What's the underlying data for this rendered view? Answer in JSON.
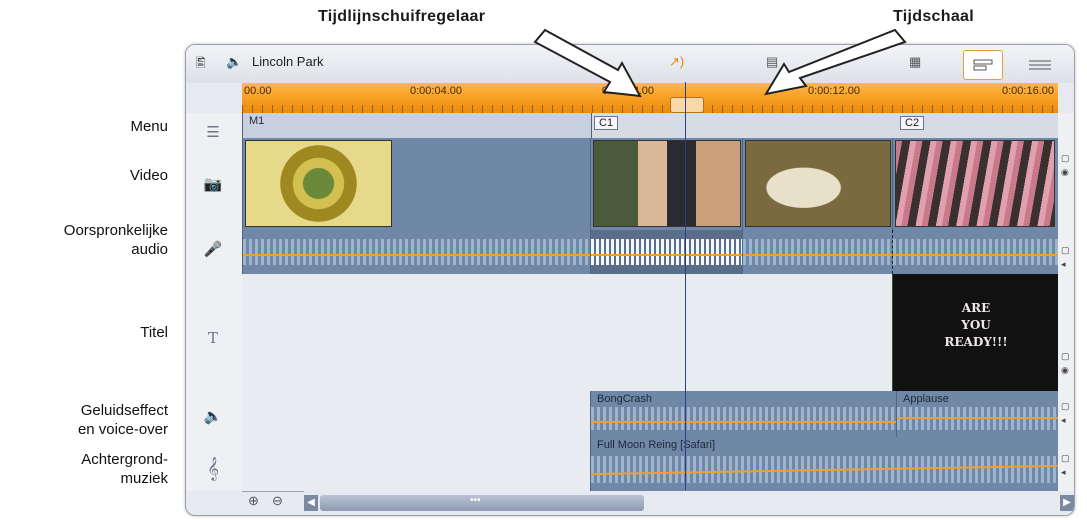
{
  "callouts": {
    "slider": "Tijdlijnschuifregelaar",
    "scale": "Tijdschaal"
  },
  "track_labels": {
    "menu": "Menu",
    "video": "Video",
    "orig_audio_1": "Oorspronkelijke",
    "orig_audio_2": "audio",
    "title": "Titel",
    "sfx_1": "Geluidseffect",
    "sfx_2": "en voice-over",
    "music_1": "Achtergrond-",
    "music_2": "muziek"
  },
  "toolbar": {
    "project_name": "Lincoln Park"
  },
  "ruler": {
    "ticks": [
      "00.00",
      "0:00:04.00",
      "0:00:08.00",
      "0:00:12.00",
      "0:00:16.00"
    ]
  },
  "menu_track": {
    "clip_label": "M1",
    "chapters": [
      "C1",
      "C2"
    ]
  },
  "title_clip": {
    "line1": "ARE",
    "line2": "YOU",
    "line3": "READY!!!"
  },
  "sfx_track": {
    "clip1": "BongCrash",
    "clip2": "Applause"
  },
  "music_track": {
    "clip1": "Full Moon Reing [Safari]"
  },
  "scrollbar": {
    "thumb_label": "•••"
  },
  "colors": {
    "ruler": "#f59a1c",
    "clip": "#6f88a8",
    "audio_line": "#f0a030",
    "playhead": "#2b3f8a"
  },
  "icons": {
    "storyboard": "storyboard-icon",
    "audio_toggle": "speaker-icon",
    "audio_scrub": "audio-scrub-icon",
    "menu": "menu-icon",
    "video": "video-camera-icon",
    "mic": "microphone-icon",
    "title": "title-icon",
    "sfx": "speaker-icon",
    "music": "treble-clef-icon",
    "zoom_in": "zoom-in-icon",
    "zoom_out": "zoom-out-icon"
  }
}
